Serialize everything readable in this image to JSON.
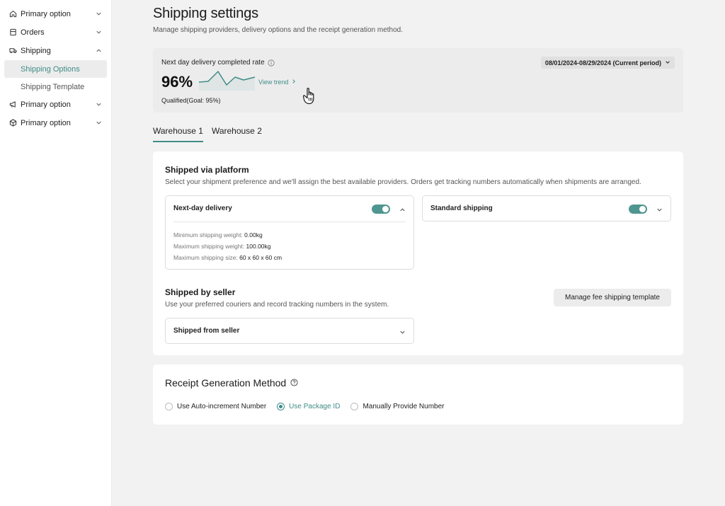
{
  "sidebar": {
    "items": [
      {
        "label": "Primary option",
        "icon": "home-icon"
      },
      {
        "label": "Orders",
        "icon": "orders-icon"
      },
      {
        "label": "Shipping",
        "icon": "truck-icon"
      },
      {
        "label": "Primary option",
        "icon": "megaphone-icon"
      },
      {
        "label": "Primary option",
        "icon": "box-icon"
      }
    ],
    "sub_items": [
      {
        "label": "Shipping Options",
        "active": true
      },
      {
        "label": "Shipping Template",
        "active": false
      }
    ]
  },
  "header": {
    "title": "Shipping settings",
    "subtitle": "Manage shipping providers, delivery options and the receipt generation method."
  },
  "stats": {
    "label": "Next day delivery completed rate",
    "value": "96%",
    "view_trend": "View trend",
    "qualified": "Qualified(Goal: 95%)",
    "period": "08/01/2024-08/29/2024 (Current period)"
  },
  "tabs": [
    {
      "label": "Warehouse 1",
      "active": true
    },
    {
      "label": "Warehouse 2",
      "active": false
    }
  ],
  "platform": {
    "title": "Shipped via platform",
    "description": "Select your shipment preference and we'll assign the best available providers. Orders get tracking numbers automatically when shipments are arranged.",
    "next_day": {
      "label": "Next-day delivery",
      "enabled": true,
      "min_weight_label": "Minimum shipping weight:",
      "min_weight": "0.00kg",
      "max_weight_label": "Maximum shipping weight:",
      "max_weight": "100.00kg",
      "max_size_label": "Maximum shipping size:",
      "max_size": "60 x 60 x 60 cm"
    },
    "standard": {
      "label": "Standard shipping",
      "enabled": true
    }
  },
  "seller": {
    "title": "Shipped by seller",
    "description": "Use your preferred couriers and record tracking numbers in the system.",
    "manage_button": "Manage fee shipping template",
    "option_label": "Shipped from seller"
  },
  "receipt": {
    "title": "Receipt Generation Method",
    "options": [
      {
        "label": "Use Auto-increment Number",
        "selected": false
      },
      {
        "label": "Use Package ID",
        "selected": true
      },
      {
        "label": "Manually Provide Number",
        "selected": false
      }
    ]
  },
  "colors": {
    "accent": "#3e8c87",
    "toggle": "#4f9690",
    "background": "#f2f2f2"
  }
}
